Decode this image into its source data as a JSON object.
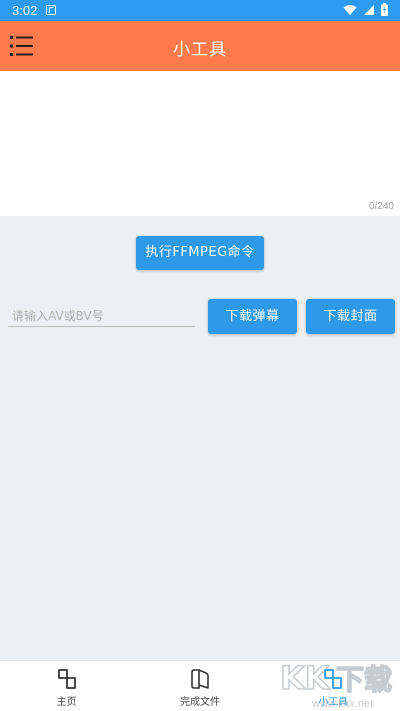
{
  "status_bar": {
    "time": "3:02",
    "icons": [
      "a-notification-icon",
      "wifi-icon",
      "signal-icon",
      "battery-icon"
    ]
  },
  "app_bar": {
    "title": "小工具",
    "menu_icon": "menu-icon",
    "background_color": "#ff7a4c"
  },
  "command_input": {
    "value": "",
    "counter": "0/240"
  },
  "ffmpeg_button": {
    "label": "执行FFMPEG命令"
  },
  "video_id_input": {
    "value": "",
    "placeholder": "请输入AV或BV号"
  },
  "download_danmu_button": {
    "label": "下载弹幕"
  },
  "download_cover_button": {
    "label": "下载封面"
  },
  "bottom_nav": {
    "items": [
      {
        "label": "主页",
        "icon": "home-squares-icon",
        "active": false
      },
      {
        "label": "完成文件",
        "icon": "book-icon",
        "active": false
      },
      {
        "label": "小工具",
        "icon": "tools-squares-icon",
        "active": true
      }
    ]
  },
  "watermark": {
    "text": "KKX下载",
    "url": "www.kkx.net"
  },
  "colors": {
    "status_bar": "#2f9bf0",
    "accent": "#2e99e6",
    "background": "#ecf0f6"
  }
}
